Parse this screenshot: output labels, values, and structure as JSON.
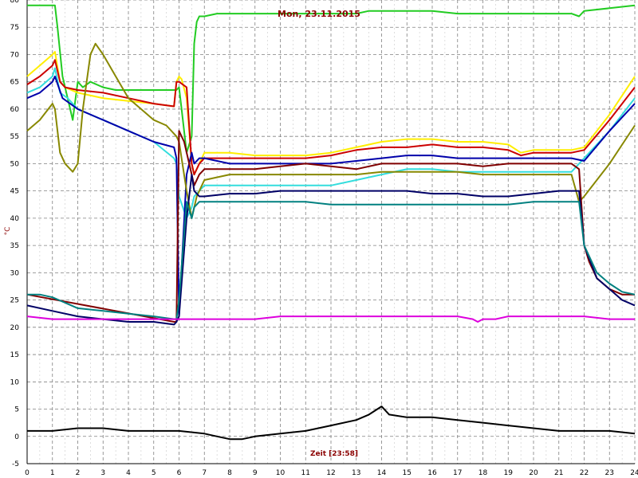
{
  "chart_data": {
    "type": "line",
    "title": "Mon, 23.11.2015",
    "xlabel": "Zeit [23:58]",
    "ylabel": "°C",
    "xlim": [
      0,
      24
    ],
    "ylim": [
      -5,
      80
    ],
    "x_ticks": [
      "0",
      "1",
      "2",
      "3",
      "4",
      "5",
      "6",
      "7",
      "8",
      "9",
      "10",
      "11",
      "12",
      "13",
      "14",
      "15",
      "16",
      "17",
      "18",
      "19",
      "20",
      "21",
      "22",
      "23",
      "24"
    ],
    "y_ticks": [
      "-5",
      "0",
      "5",
      "10",
      "15",
      "20",
      "25",
      "30",
      "35",
      "40",
      "45",
      "50",
      "55",
      "60",
      "65",
      "70",
      "75",
      "80"
    ],
    "grid": true,
    "series": [
      {
        "color": "#22cc22",
        "x": [
          0,
          1.1,
          1.2,
          1.4,
          1.6,
          1.8,
          2.0,
          2.2,
          2.5,
          3.0,
          3.5,
          4.0,
          4.5,
          5.0,
          5.5,
          5.9,
          6.0,
          6.1,
          6.3,
          6.5,
          6.6,
          6.7,
          6.8,
          7.0,
          7.5,
          8.0,
          9.0,
          10,
          11,
          12,
          13,
          13.5,
          14,
          15,
          16,
          17,
          18,
          19,
          20,
          21,
          21.5,
          21.8,
          22,
          23,
          24
        ],
        "y": [
          79,
          79,
          75,
          66,
          62,
          58,
          65,
          64,
          65,
          64,
          63.5,
          63.5,
          63.5,
          63.5,
          63.5,
          63.5,
          64,
          60,
          52,
          55,
          72,
          76,
          77,
          77,
          77.5,
          77.5,
          77.5,
          77.5,
          77.5,
          77.5,
          77.5,
          78,
          78,
          78,
          78,
          77.5,
          77.5,
          77.5,
          77.5,
          77.5,
          77.5,
          77,
          78,
          78.5,
          79
        ]
      },
      {
        "color": "#ffee00",
        "x": [
          0,
          0.5,
          1.0,
          1.1,
          1.3,
          1.5,
          2,
          3,
          4,
          5,
          5.8,
          5.9,
          6.0,
          6.1,
          6.3,
          6.5,
          6.6,
          6.8,
          7,
          8,
          9,
          10,
          11,
          12,
          13,
          14,
          15,
          16,
          17,
          18,
          19,
          19.5,
          20,
          21,
          21.5,
          22,
          23,
          24
        ],
        "y": [
          66,
          68,
          70,
          70.5,
          65,
          64,
          63,
          62,
          61.5,
          61,
          60.5,
          65,
          66,
          65.5,
          62,
          50,
          48,
          50,
          52,
          52,
          51.5,
          51.5,
          51.5,
          52,
          53,
          54,
          54.5,
          54.5,
          54,
          54,
          53.5,
          52,
          52.5,
          52.5,
          52.5,
          53,
          59,
          66
        ]
      },
      {
        "color": "#cc0000",
        "x": [
          0,
          0.5,
          1.0,
          1.1,
          1.3,
          1.5,
          2,
          3,
          4,
          5,
          5.8,
          5.9,
          6.0,
          6.3,
          6.5,
          6.6,
          6.8,
          7,
          8,
          9,
          10,
          11,
          12,
          13,
          14,
          15,
          16,
          17,
          18,
          19,
          19.5,
          20,
          21,
          21.5,
          22,
          23,
          24
        ],
        "y": [
          64.5,
          66,
          68,
          69,
          65,
          64,
          63.5,
          63,
          62,
          61,
          60.5,
          65,
          65,
          64,
          50,
          48,
          50,
          51,
          51,
          51,
          51,
          51,
          51.5,
          52.5,
          53,
          53,
          53.5,
          53,
          53,
          52.5,
          51.5,
          52,
          52,
          52,
          52.5,
          58,
          64
        ]
      },
      {
        "color": "#33dddd",
        "x": [
          0,
          0.5,
          1.0,
          1.1,
          1.3,
          1.6,
          2,
          3,
          4,
          5,
          5.8,
          5.9,
          6.0,
          6.3,
          6.5,
          6.6,
          7,
          8,
          9,
          10,
          11,
          12,
          13,
          14,
          15,
          16,
          17,
          18,
          19,
          20,
          21,
          21.5,
          22,
          23,
          24
        ],
        "y": [
          63,
          64,
          66,
          67.5,
          63,
          62,
          60,
          58,
          56,
          54,
          51,
          50,
          44,
          40,
          42,
          44,
          46,
          46,
          46,
          46,
          46,
          46,
          47,
          48,
          49,
          49,
          48.5,
          48.5,
          48.5,
          48.5,
          48.5,
          48.5,
          51,
          56,
          62
        ]
      },
      {
        "color": "#0000aa",
        "x": [
          0,
          0.5,
          1.0,
          1.1,
          1.4,
          1.7,
          2,
          3,
          4,
          5,
          5.8,
          5.9,
          6.0,
          6.3,
          6.5,
          6.6,
          6.8,
          7,
          8,
          9,
          10,
          11,
          12,
          13,
          14,
          15,
          16,
          17,
          18,
          19,
          20,
          21,
          21.5,
          22,
          23,
          24
        ],
        "y": [
          62,
          63,
          65,
          66,
          62,
          61,
          60,
          58,
          56,
          54,
          53,
          51,
          22,
          48,
          52,
          50,
          51,
          51,
          50,
          50,
          50,
          50,
          50,
          50.5,
          51,
          51.5,
          51.5,
          51,
          51,
          51,
          51,
          51,
          51,
          50.5,
          56,
          61
        ]
      },
      {
        "color": "#888800",
        "x": [
          0,
          0.5,
          1.0,
          1.1,
          1.3,
          1.5,
          1.8,
          2.0,
          2.2,
          2.5,
          2.7,
          3,
          3.5,
          4,
          4.5,
          5,
          5.5,
          5.9,
          6.0,
          6.3,
          6.5,
          6.7,
          7,
          8,
          9,
          10,
          11,
          12,
          13,
          14,
          15,
          16,
          17,
          18,
          19,
          20,
          21,
          21.5,
          21.8,
          22,
          23,
          24
        ],
        "y": [
          56,
          58,
          61,
          60,
          52,
          50,
          48.5,
          50,
          60,
          70,
          72,
          70,
          66,
          62,
          60,
          58,
          57,
          55,
          54,
          45,
          40,
          44,
          47,
          48,
          48,
          48,
          48,
          48,
          48,
          48.5,
          48.5,
          48.5,
          48.5,
          48,
          48,
          48,
          48,
          48,
          43,
          44,
          50,
          57
        ]
      },
      {
        "color": "#800000",
        "x": [
          0,
          5.8,
          5.9,
          6.0,
          6.2,
          6.5,
          6.6,
          6.8,
          7,
          8,
          9,
          10,
          11,
          12,
          13,
          14,
          15,
          16,
          17,
          18,
          19,
          20,
          21,
          21.5,
          21.8,
          22,
          22.2,
          22.5,
          23,
          23.5,
          24
        ],
        "y": [
          26,
          21,
          21,
          56,
          54,
          48,
          46,
          48,
          49,
          49,
          49,
          49.5,
          50,
          49.5,
          49,
          50,
          50,
          50,
          50,
          49.5,
          50,
          50,
          50,
          50,
          49,
          35,
          32,
          29,
          27,
          26,
          26
        ]
      },
      {
        "color": "#000066",
        "x": [
          0,
          1,
          2,
          3,
          4,
          5,
          5.8,
          5.9,
          6.0,
          6.3,
          6.5,
          6.6,
          6.8,
          7,
          8,
          9,
          10,
          11,
          12,
          13,
          14,
          15,
          16,
          17,
          18,
          19,
          20,
          21,
          21.5,
          21.8,
          22,
          22.5,
          23,
          23.5,
          24
        ],
        "y": [
          24,
          23,
          22,
          21.5,
          21,
          21,
          20.5,
          21,
          22,
          40,
          48,
          45,
          44,
          44,
          44.5,
          44.5,
          45,
          45,
          45,
          45,
          45,
          45,
          44.5,
          44.5,
          44,
          44,
          44.5,
          45,
          45,
          45,
          35,
          29,
          27,
          25,
          24
        ]
      },
      {
        "color": "#008080",
        "x": [
          0,
          0.5,
          1,
          1.5,
          2,
          3,
          4,
          5,
          5.8,
          5.9,
          6.0,
          6.3,
          6.5,
          6.6,
          6.8,
          7,
          8,
          9,
          10,
          11,
          12,
          13,
          14,
          15,
          16,
          17,
          18,
          19,
          20,
          21,
          21.5,
          21.8,
          22,
          22.5,
          23,
          23.5,
          24
        ],
        "y": [
          26,
          26,
          25.5,
          24.5,
          23.5,
          23,
          22.5,
          22,
          21.5,
          21.5,
          25,
          43,
          40,
          42,
          43,
          43,
          43,
          43,
          43,
          43,
          42.5,
          42.5,
          42.5,
          42.5,
          42.5,
          42.5,
          42.5,
          42.5,
          43,
          43,
          43,
          43,
          35,
          30,
          28,
          26.5,
          26
        ]
      },
      {
        "color": "#dd00dd",
        "x": [
          0,
          1,
          2,
          3,
          4,
          5,
          6,
          7,
          8,
          9,
          10,
          11,
          12,
          13,
          14,
          15,
          16,
          17,
          17.6,
          17.8,
          18,
          18.5,
          19,
          20,
          21,
          22,
          23,
          24
        ],
        "y": [
          22,
          21.5,
          21.5,
          21.5,
          21.5,
          21.5,
          21.5,
          21.5,
          21.5,
          21.5,
          22,
          22,
          22,
          22,
          22,
          22,
          22,
          22,
          21.5,
          21,
          21.5,
          21.5,
          22,
          22,
          22,
          22,
          21.5,
          21.5
        ]
      },
      {
        "color": "#000000",
        "x": [
          0,
          1,
          2,
          3,
          4,
          5,
          6,
          7,
          7.5,
          8,
          8.5,
          9,
          10,
          11,
          12,
          13,
          13.5,
          14,
          14.3,
          15,
          16,
          17,
          18,
          19,
          20,
          21,
          22,
          23,
          24
        ],
        "y": [
          1,
          1,
          1.5,
          1.5,
          1,
          1,
          1,
          0.5,
          0,
          -0.5,
          -0.5,
          0,
          0.5,
          1,
          2,
          3,
          4,
          5.5,
          4,
          3.5,
          3.5,
          3,
          2.5,
          2,
          1.5,
          1,
          1,
          1,
          0.5
        ]
      }
    ]
  }
}
